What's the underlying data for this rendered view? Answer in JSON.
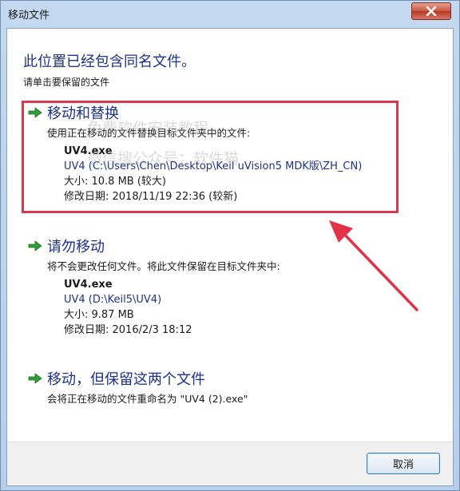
{
  "window": {
    "title": "移动文件"
  },
  "header": {
    "title": "此位置已经包含同名文件。",
    "subtitle": "请单击要保留的文件"
  },
  "options": [
    {
      "title": "移动和替换",
      "description": "使用正在移动的文件替换目标文件夹中的文件:",
      "file": {
        "name": "UV4.exe",
        "path": "UV4 (C:\\Users\\Chen\\Desktop\\Keil uVision5 MDK版\\ZH_CN)",
        "size": "大小: 10.8 MB (较大)",
        "modified": "修改日期: 2018/11/19 22:36 (较新)"
      }
    },
    {
      "title": "请勿移动",
      "description": "将不会更改任何文件。将此文件保留在目标文件夹中:",
      "file": {
        "name": "UV4.exe",
        "path": "UV4 (D:\\Keil5\\UV4)",
        "size": "大小: 9.87 MB",
        "modified": "修改日期: 2016/2/3 18:12"
      }
    },
    {
      "title": "移动，但保留这两个文件",
      "description": "会将正在移动的文件重命名为 \"UV4 (2).exe\""
    }
  ],
  "watermark": {
    "line1": "免费软件安装教程",
    "line2": "微信搜公众号：软件猫"
  },
  "footer": {
    "cancel_label": "取消"
  },
  "colors": {
    "accent_text": "#1e3287",
    "highlight": "#d8384b",
    "close_button": "#c9553f"
  }
}
